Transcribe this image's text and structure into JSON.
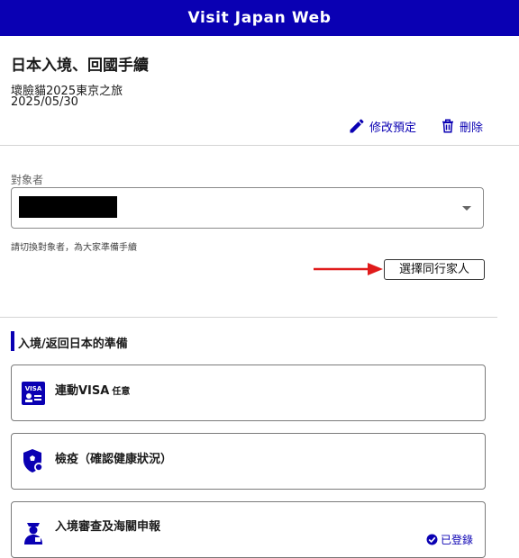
{
  "header": {
    "title": "Visit Japan Web"
  },
  "page": {
    "title": "日本入境、回國手續",
    "trip_name": "壞臉貓2025東京之旅",
    "trip_date": "2025/05/30"
  },
  "actions": {
    "edit_label": "修改預定",
    "delete_label": "刪除"
  },
  "target": {
    "label": "對象者",
    "helper": "請切換對象者，為大家準備手續",
    "companion_button": "選擇同行家人"
  },
  "section": {
    "title": "入境/返回日本的準備"
  },
  "cards": [
    {
      "title": "連動VISA",
      "badge": "任意",
      "icon": "visa-icon"
    },
    {
      "title": "檢疫（確認健康狀況）",
      "icon": "quarantine-shield-icon"
    },
    {
      "title": "入境審查及海關申報",
      "icon": "immigration-officer-icon",
      "status": "已登錄"
    }
  ],
  "colors": {
    "brand": "#0a00b3",
    "arrow": "#e01b1b"
  }
}
